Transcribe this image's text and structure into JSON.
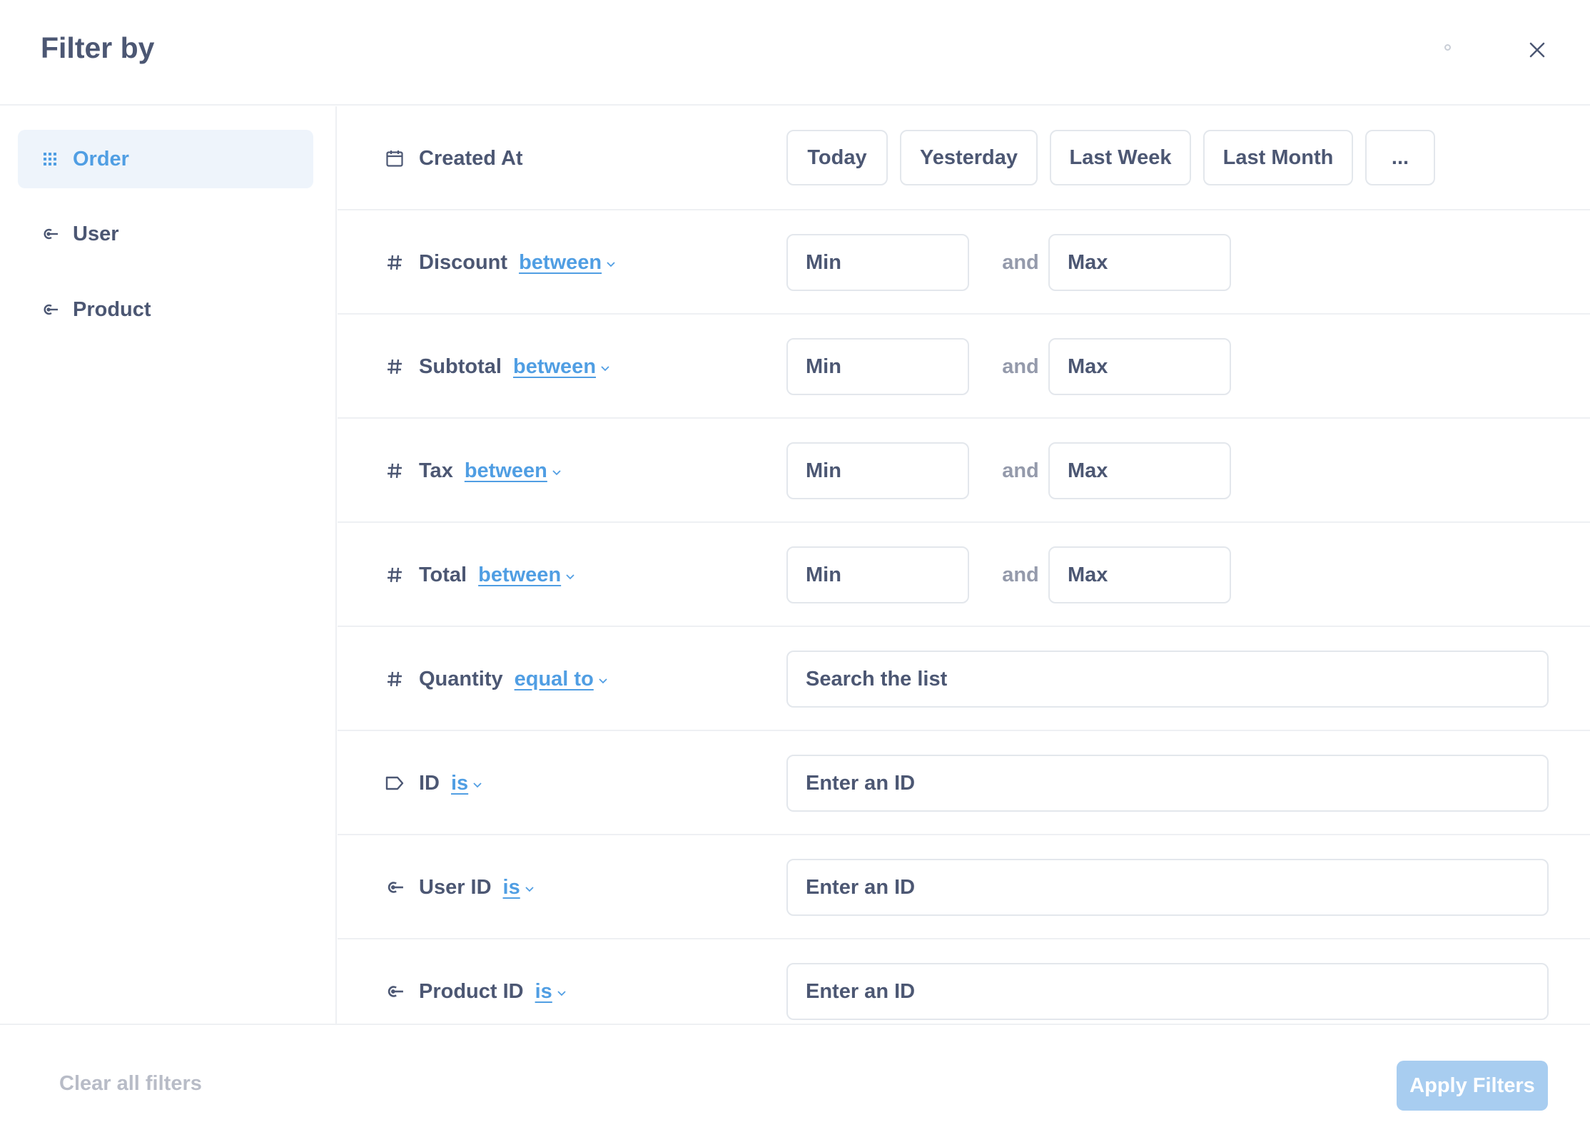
{
  "header": {
    "title": "Filter by"
  },
  "sidebar": {
    "items": [
      {
        "label": "Order",
        "icon": "grid-icon",
        "active": true
      },
      {
        "label": "User",
        "icon": "foreign-key-icon",
        "active": false
      },
      {
        "label": "Product",
        "icon": "foreign-key-icon",
        "active": false
      }
    ]
  },
  "filters": [
    {
      "name": "Created At",
      "icon": "calendar-icon",
      "operator": "",
      "shortcuts": [
        "Today",
        "Yesterday",
        "Last Week",
        "Last Month",
        "..."
      ]
    },
    {
      "name": "Discount",
      "icon": "number-icon",
      "operator": "between",
      "min_placeholder": "Min",
      "and_label": "and",
      "max_placeholder": "Max"
    },
    {
      "name": "Subtotal",
      "icon": "number-icon",
      "operator": "between",
      "min_placeholder": "Min",
      "and_label": "and",
      "max_placeholder": "Max"
    },
    {
      "name": "Tax",
      "icon": "number-icon",
      "operator": "between",
      "min_placeholder": "Min",
      "and_label": "and",
      "max_placeholder": "Max"
    },
    {
      "name": "Total",
      "icon": "number-icon",
      "operator": "between",
      "min_placeholder": "Min",
      "and_label": "and",
      "max_placeholder": "Max"
    },
    {
      "name": "Quantity",
      "icon": "number-icon",
      "operator": "equal to",
      "placeholder": "Search the list"
    },
    {
      "name": "ID",
      "icon": "label-icon",
      "operator": "is",
      "placeholder": "Enter an ID"
    },
    {
      "name": "User ID",
      "icon": "foreign-key-icon",
      "operator": "is",
      "placeholder": "Enter an ID"
    },
    {
      "name": "Product ID",
      "icon": "foreign-key-icon",
      "operator": "is",
      "placeholder": "Enter an ID"
    }
  ],
  "footer": {
    "clear_label": "Clear all filters",
    "apply_label": "Apply Filters"
  },
  "colors": {
    "brand": "#509ee3",
    "text": "#4c5773",
    "muted": "#949aab",
    "border": "#e3e7ec",
    "apply_disabled": "#a8cdf0"
  }
}
